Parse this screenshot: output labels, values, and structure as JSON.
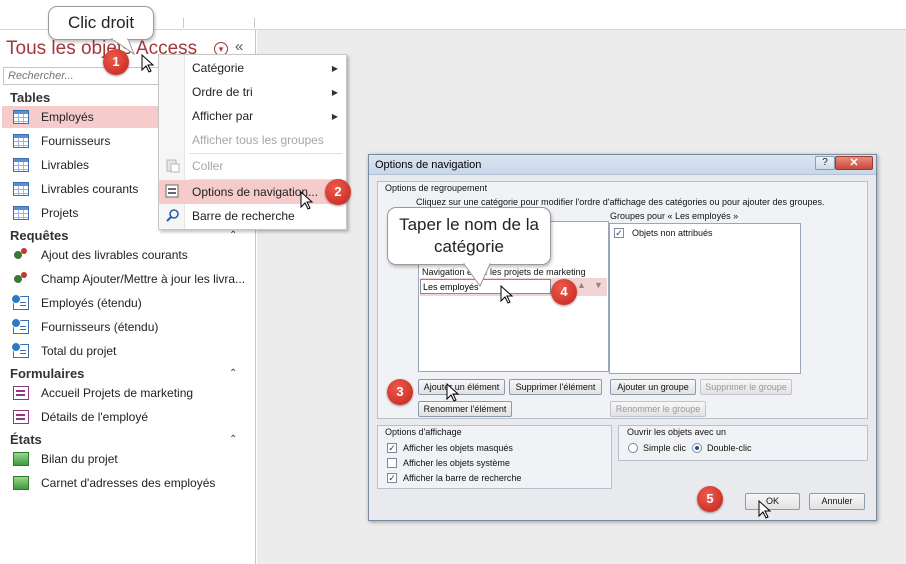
{
  "nav": {
    "title": "Tous les objets Access",
    "search_placeholder": "Rechercher...",
    "groups": [
      {
        "label": "Tables",
        "items": [
          "Employés",
          "Fournisseurs",
          "Livrables",
          "Livrables courants",
          "Projets"
        ]
      },
      {
        "label": "Requêtes",
        "items": [
          "Ajout des livrables courants",
          "Champ Ajouter/Mettre à jour les livra...",
          "Employés (étendu)",
          "Fournisseurs (étendu)",
          "Total du projet"
        ]
      },
      {
        "label": "Formulaires",
        "items": [
          "Accueil Projets de marketing",
          "Détails de l'employé"
        ]
      },
      {
        "label": "États",
        "items": [
          "Bilan du projet",
          "Carnet d'adresses des employés"
        ]
      }
    ]
  },
  "context_menu": {
    "items": [
      "Catégorie",
      "Ordre de tri",
      "Afficher par",
      "Afficher tous les groupes",
      "Coller",
      "Options de navigation...",
      "Barre de recherche"
    ]
  },
  "dialog": {
    "title": "Options de navigation",
    "help": "?",
    "close": "✕",
    "grouping_title": "Options de regroupement",
    "instruction": "Cliquez sur une catégorie pour modifier l'ordre d'affichage des catégories ou pour ajouter des groupes.",
    "left_header": "Navigation entre les projets de marketing",
    "edit_value": "Les employés",
    "right_header": "Groupes pour « Les employés »",
    "right_item": "Objets non attribués",
    "btn_add_item": "Ajouter un élément",
    "btn_delete_item": "Supprimer l'élément",
    "btn_rename_item": "Renommer l'élément",
    "btn_add_group": "Ajouter un groupe",
    "btn_delete_group": "Supprimer le groupe",
    "btn_rename_group": "Renommer le groupe",
    "display_title": "Options d'affichage",
    "display_opts": [
      "Afficher les objets masqués",
      "Afficher les objets système",
      "Afficher la barre de recherche"
    ],
    "open_title": "Ouvrir les objets avec un",
    "open_opts": [
      "Simple clic",
      "Double-clic"
    ],
    "ok": "OK",
    "cancel": "Annuler"
  },
  "callouts": {
    "right_click": "Clic droit",
    "type_name": "Taper le nom de la catégorie",
    "numbers": [
      "1",
      "2",
      "3",
      "4",
      "5"
    ]
  },
  "colors": {
    "accent": "#a4373a",
    "selection": "#f5cbcb",
    "marker": "#d9332a"
  }
}
